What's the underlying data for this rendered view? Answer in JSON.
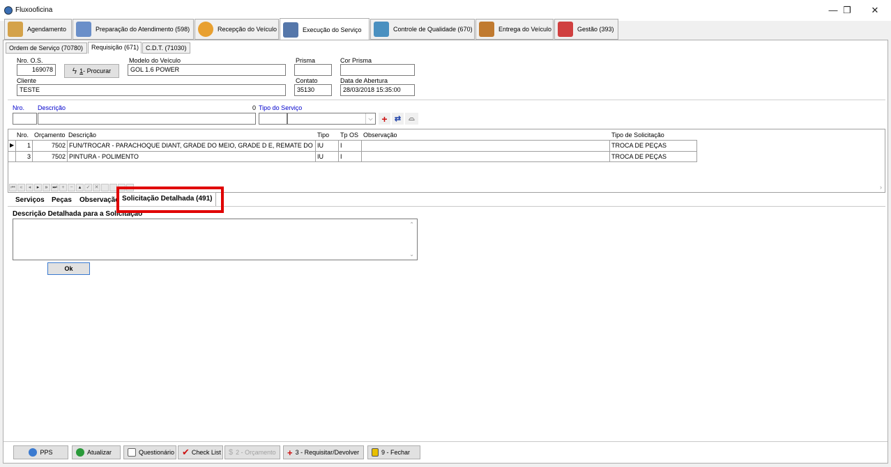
{
  "window": {
    "title": "Fluxooficina",
    "minimize": "—",
    "restore": "❐",
    "close": "✕"
  },
  "main_tabs": [
    {
      "label": "Agendamento",
      "icon": "person-icon",
      "color": "#d4a24a"
    },
    {
      "label": "Preparação do Atendimento (598)",
      "icon": "list-icon",
      "color": "#6a8fc9"
    },
    {
      "label": "Recepção do Veículo",
      "icon": "location-icon",
      "color": "#e8a030"
    },
    {
      "label": "Execução do Serviço",
      "icon": "mechanic-icon",
      "color": "#5577aa"
    },
    {
      "label": "Controle de Qualidade (670)",
      "icon": "magnifier-icon",
      "color": "#4a90c0"
    },
    {
      "label": "Entrega do Veículo",
      "icon": "checklist-icon",
      "color": "#c07a30"
    },
    {
      "label": "Gestão (393)",
      "icon": "gauge-icon",
      "color": "#d04040"
    }
  ],
  "sub_tabs": [
    "Ordem de Serviço (70780)",
    "Requisição (671)",
    "C.D.T. (71030)"
  ],
  "header_form": {
    "os_label": "Nro. O.S.",
    "os_value": "169078",
    "search_button_key": "1",
    "search_button_label": " - Procurar",
    "model_label": "Modelo do Veículo",
    "model_value": "GOL 1.6 POWER",
    "prisma_label": "Prisma",
    "prisma_value": "",
    "cor_prisma_label": "Cor Prisma",
    "cor_prisma_value": "",
    "client_label": "Cliente",
    "client_value": "TESTE",
    "contact_label": "Contato",
    "contact_value": "35130",
    "open_date_label": "Data de Abertura",
    "open_date_value": "28/03/2018 15:35:00"
  },
  "service_form": {
    "nro_label": "Nro.",
    "desc_label": "Descrição",
    "zero_label": "0",
    "tipo_label": "Tipo do Serviço"
  },
  "grid": {
    "columns": [
      "Nro.",
      "Orçamento",
      "Descrição",
      "Tipo",
      "Tp OS",
      "Observação",
      "Tipo de Solicitação"
    ],
    "rows": [
      {
        "nro": "1",
        "orcamento": "7502",
        "descricao": "FUN/TROCAR - PARACHOQUE DIANT, GRADE DO MEIO, GRADE D E, REMATE DO PARACHOQUE",
        "tipo": "IU",
        "tp_os": "I",
        "observacao": "",
        "tipo_solicitacao": "TROCA DE PEÇAS"
      },
      {
        "nro": "3",
        "orcamento": "7502",
        "descricao": "PINTURA - POLIMENTO",
        "tipo": "IU",
        "tp_os": "I",
        "observacao": "",
        "tipo_solicitacao": "TROCA DE PEÇAS"
      }
    ]
  },
  "detail_tabs": [
    "Serviços",
    "Peças",
    "Observação",
    "Solicitação Detalhada (491)"
  ],
  "detail": {
    "memo_label": "Descrição Detalhada para a Solicitação",
    "memo_value": "",
    "ok_label": "Ok"
  },
  "bottom_buttons": [
    {
      "label": "PPS",
      "icon": "globe-icon",
      "color": "#3a7ad0",
      "disabled": false
    },
    {
      "label": "Atualizar",
      "icon": "refresh-icon",
      "color": "#2a9a3a",
      "disabled": false
    },
    {
      "label": "Questionário",
      "icon": "questionnaire-icon",
      "color": "#666666",
      "disabled": false
    },
    {
      "label": "Check List",
      "icon": "check-icon",
      "color": "#cc1111",
      "disabled": false
    },
    {
      "label": "2 - Orçamento",
      "icon": "dollar-icon",
      "color": "#aaaaaa",
      "disabled": true
    },
    {
      "label": "3 - Requisitar/Devolver",
      "icon": "plus-icon",
      "color": "#cc1111",
      "disabled": false
    },
    {
      "label": "9 - Fechar",
      "icon": "exit-icon",
      "color": "#e8c000",
      "disabled": false
    }
  ]
}
